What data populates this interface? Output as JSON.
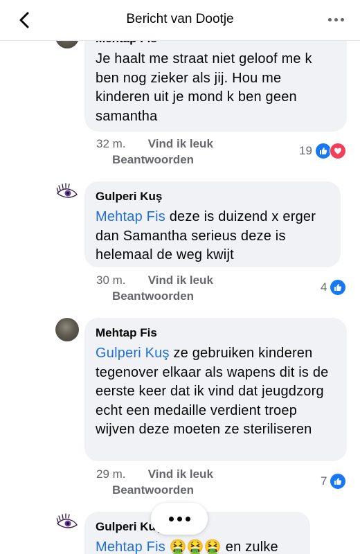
{
  "header": {
    "title": "Bericht van Dootje"
  },
  "comments": [
    {
      "author": "Mehtap Fis",
      "text": "Je haalt me straat niet geloof me k ben nog zieker als jij. Hou me kinderen uit je mond k ben geen samantha",
      "time": "32 m.",
      "like_label": "Vind ik leuk",
      "reply_label": "Beantwoorden",
      "reaction_count": "19",
      "reactions": [
        "like-icon",
        "love-icon"
      ]
    },
    {
      "author": "Gulperi Kuş",
      "mention": "Mehtap Fis",
      "text": " deze is duizend x erger dan Samantha serieus deze is helemaal de weg kwijt",
      "time": "30 m.",
      "like_label": "Vind ik leuk",
      "reply_label": "Beantwoorden",
      "reaction_count": "4",
      "reactions": [
        "like-icon"
      ]
    },
    {
      "author": "Mehtap Fis",
      "mention": "Gulperi Kuş",
      "text": " ze gebruiken kinderen tegenover elkaar als wapens dit is de eerste keer dat ik vind dat jeugdzorg echt een medaille verdient troep wijven deze moeten ze steriliseren",
      "time": "29 m.",
      "like_label": "Vind ik leuk",
      "reply_label": "Beantwoorden",
      "reaction_count": "7",
      "reactions": [
        "like-icon"
      ]
    },
    {
      "author": "Gulperi Kuş",
      "mention": "Mehtap Fis",
      "text": " 🤮🤮🤮 en zulke"
    }
  ],
  "colors": {
    "mention": "#216fdb",
    "like": "#1877f2",
    "love": "#f33e58",
    "bubble": "#f0f2f5"
  }
}
